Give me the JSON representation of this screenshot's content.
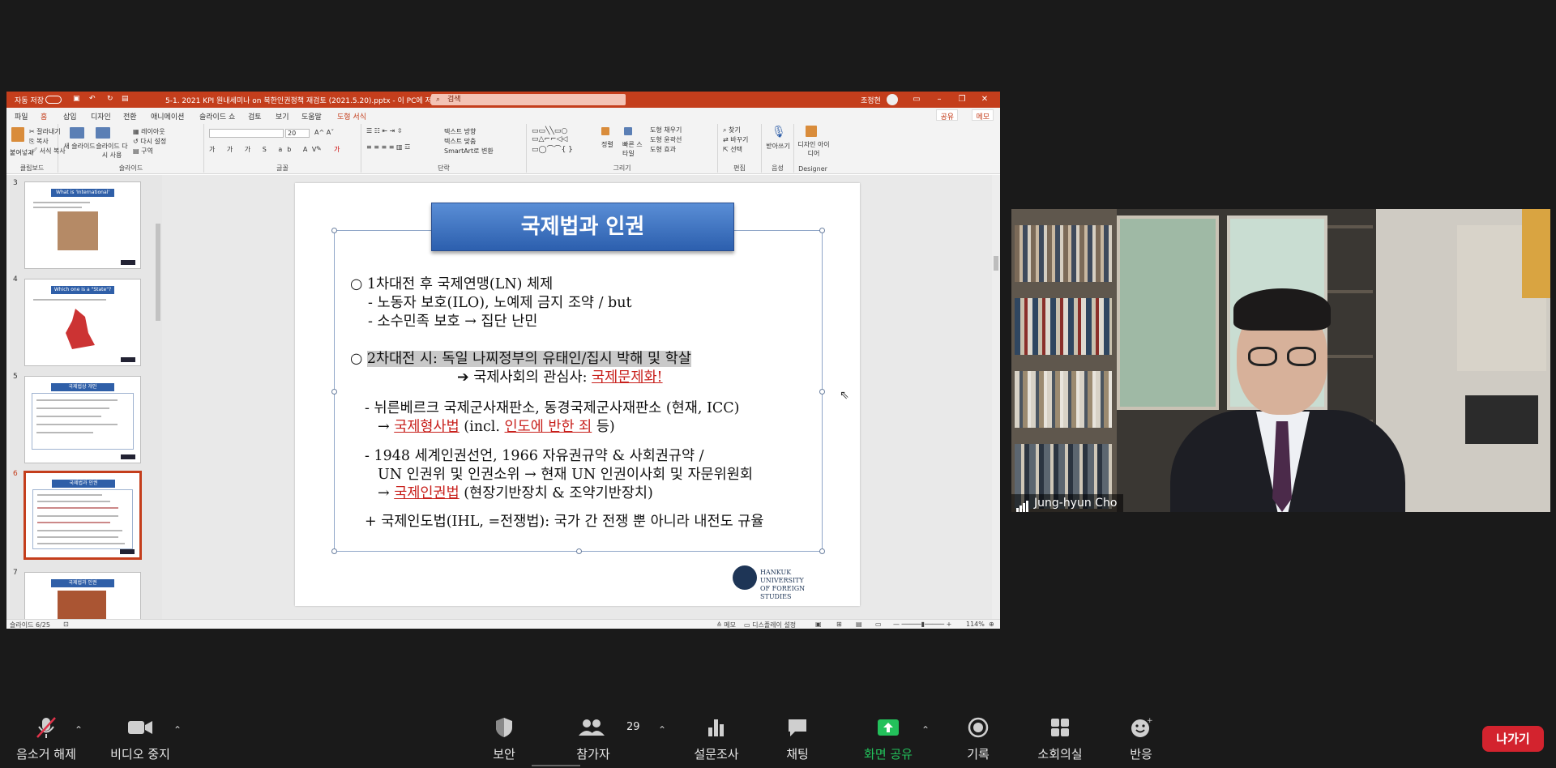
{
  "ppt": {
    "titlebar": {
      "autosave": "자동 저장",
      "filename": "5-1. 2021 KPI 원내세미나 on 북한인권정책 재검토 (2021.5.20).pptx - 이 PC에 저장됨",
      "search_placeholder": "검색",
      "user": "조정현"
    },
    "tabs": [
      "파일",
      "홈",
      "삽입",
      "디자인",
      "전환",
      "애니메이션",
      "슬라이드 쇼",
      "검토",
      "보기",
      "도움말",
      "도형 서식"
    ],
    "active_tab": "홈",
    "share_label": "공유",
    "memo_label": "메모",
    "ribbon": {
      "groups": [
        "클립보드",
        "슬라이드",
        "글꼴",
        "단락",
        "그리기",
        "편집",
        "음성",
        "Designer"
      ],
      "paste": "붙여넣기",
      "cut": "잘라내기",
      "copy": "복사",
      "format_painter": "서식 복사",
      "new_slide": "새 슬라이드",
      "reuse_slide": "슬라이드 다시 사용",
      "layout": "레이아웃",
      "reset": "다시 설정",
      "section": "구역",
      "font_size": "20",
      "text_direction": "텍스트 방향",
      "align_text": "텍스트 맞춤",
      "smartart": "SmartArt로 변환",
      "arrange": "정렬",
      "quick_styles": "빠른 스타일",
      "shape_fill": "도형 채우기",
      "shape_outline": "도형 윤곽선",
      "shape_effects": "도형 효과",
      "find": "찾기",
      "replace": "바꾸기",
      "select": "선택",
      "dictate": "받아쓰기",
      "designer": "디자인 아이디어"
    },
    "thumbnails": [
      {
        "num": "3",
        "title": "What is 'International' Law?"
      },
      {
        "num": "4",
        "title": "Which one is a \"State\"?"
      },
      {
        "num": "5",
        "title": "국제법상 개인"
      },
      {
        "num": "6",
        "title": "국제법과 인권"
      },
      {
        "num": "7",
        "title": "국제법과 인권"
      }
    ],
    "active_slide": "6",
    "slide": {
      "title": "국제법과 인권",
      "l1": "○ 1차대전 후 국제연맹(LN) 체제",
      "l2": "- 노동자 보호(ILO), 노예제 금지 조약 / but",
      "l3": "- 소수민족 보호 → 집단 난민",
      "l4_mark": "○ ",
      "l4": "2차대전 시: 독일 나찌정부의 유태인/집시 박해 및 학살",
      "l5": "➔ 국제사회의 관심사: ",
      "l5_red": "국제문제화!",
      "l6": "- 뉘른베르크 국제군사재판소, 동경국제군사재판소 (현재, ICC)",
      "l7_a": "→ ",
      "l7_red1": "국제형사법",
      "l7_b": " (incl. ",
      "l7_red2": "인도에 반한 죄",
      "l7_c": " 등)",
      "l8": "- 1948 세계인권선언, 1966 자유권규약 & 사회권규약 /",
      "l9": "UN 인권위 및 인권소위 → 현재 UN 인권이사회 및 자문위원회",
      "l10_a": "→ ",
      "l10_red": "국제인권법",
      "l10_b": " (현장기반장치 & 조약기반장치)",
      "l11": "+ 국제인도법(IHL, =전쟁법): 국가 간 전쟁 뿐 아니라 내전도 규율",
      "logo_line1": "HANKUK UNIVERSITY",
      "logo_line2": "OF FOREIGN STUDIES"
    },
    "status": {
      "slide_counter": "슬라이드 6/25",
      "notes": "메모",
      "display_settings": "디스플레이 설정",
      "zoom": "114%"
    }
  },
  "video": {
    "participant_name": "Jung-hyun Cho"
  },
  "zoom_controls": {
    "mute": "음소거 해제",
    "video": "비디오 중지",
    "security": "보안",
    "participants": "참가자",
    "participant_count": "29",
    "polls": "설문조사",
    "chat": "채팅",
    "share_screen": "화면 공유",
    "record": "기록",
    "breakout": "소회의실",
    "reactions": "반응",
    "leave": "나가기"
  },
  "colors": {
    "ppt_accent": "#c43e1c",
    "slide_title_bg": "#3a6fc0",
    "red_text": "#c8201c",
    "share_green": "#23c15b",
    "leave_red": "#d3232e"
  }
}
